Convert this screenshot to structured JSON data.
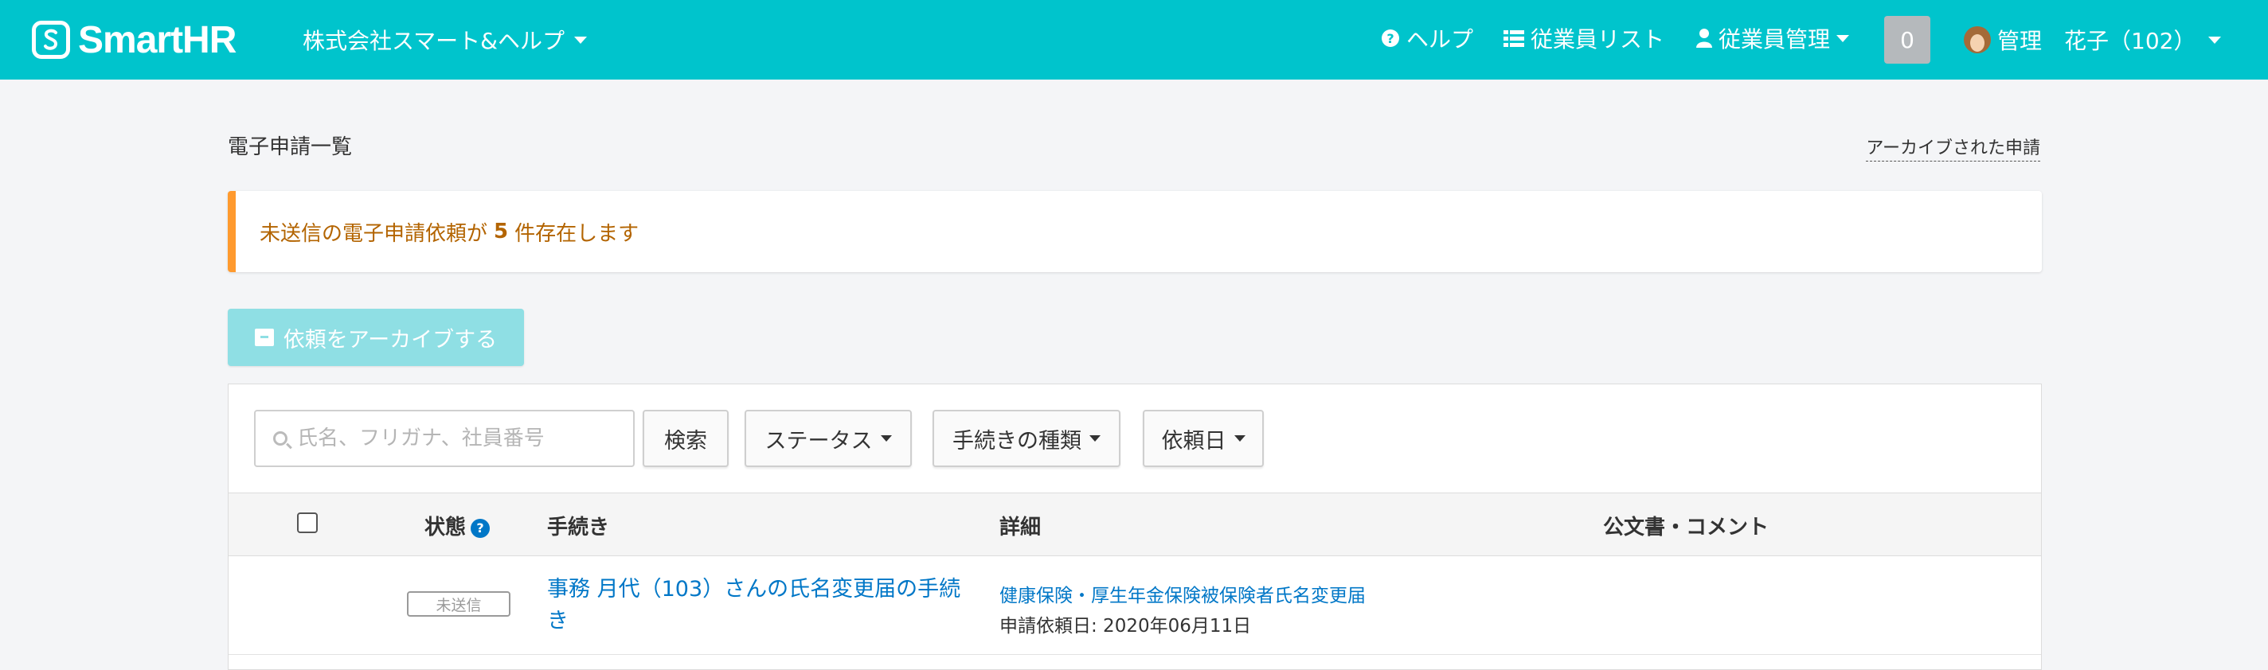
{
  "header": {
    "brand": "SmartHR",
    "company": "株式会社スマート&ヘルプ",
    "help": "ヘルプ",
    "employee_list": "従業員リスト",
    "employee_manage": "従業員管理",
    "notification_count": "0",
    "user_name": "管理　花子（102）",
    "brand_color": "#00c4cc"
  },
  "page": {
    "title": "電子申請一覧",
    "archived_link": "アーカイブされた申請"
  },
  "alert": {
    "prefix": "未送信の電子申請依頼が",
    "count": "5",
    "suffix": "件存在します",
    "accent_color": "#ff9a2e"
  },
  "archive_button": {
    "label": "依頼をアーカイブする"
  },
  "filters": {
    "search_placeholder": "氏名、フリガナ、社員番号",
    "search_value": "",
    "search_button": "検索",
    "status": "ステータス",
    "procedure_type": "手続きの種類",
    "request_date": "依頼日"
  },
  "table": {
    "columns": {
      "status": "状態",
      "procedure": "手続き",
      "details": "詳細",
      "documents": "公文書・コメント"
    },
    "rows": [
      {
        "status": "未送信",
        "procedure": "事務 月代（103）さんの氏名変更届の手続き",
        "detail": "健康保険・厚生年金保険被保険者氏名変更届",
        "date": "申請依頼日: 2020年06月11日",
        "documents": ""
      }
    ]
  }
}
